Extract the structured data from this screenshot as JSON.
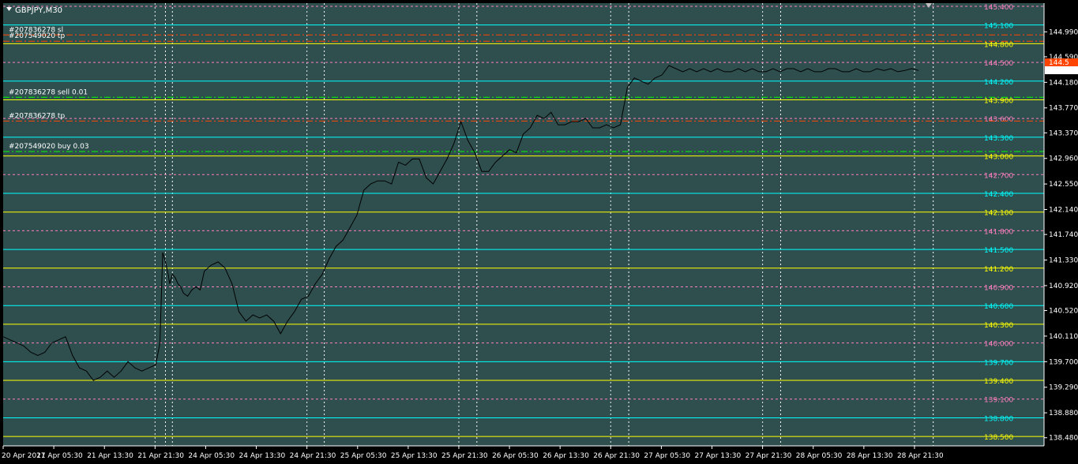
{
  "chart_data": {
    "type": "line",
    "symbol_timeframe": "GBPJPY,M30",
    "colors": {
      "plot_bg": "#2f4f4f",
      "frame_bg": "#000000",
      "price_line": "#000000",
      "grid": "#ffffff",
      "level_cyan": "#00ffff",
      "level_yellow": "#ffff00",
      "level_pink": "#ff7fbf",
      "sl_tp_red": "#ff4500",
      "entry_green": "#00ff00",
      "axis_text": "#ffffff",
      "current_price_bg": "#ffffff",
      "alert_bg": "#ff4500"
    },
    "y_axis": {
      "range": [
        138.35,
        145.45
      ],
      "ticks": [
        "144.990",
        "144.590",
        "144.180",
        "143.770",
        "143.370",
        "142.960",
        "142.550",
        "142.140",
        "141.740",
        "141.330",
        "140.920",
        "140.520",
        "140.110",
        "139.700",
        "139.290",
        "138.880",
        "138.480"
      ]
    },
    "current_price": "144.374",
    "alert_price_partial": "144.5",
    "x_axis": {
      "range": [
        0,
        1000
      ],
      "labels": [
        {
          "x": 0,
          "text": "20 Apr 2017"
        },
        {
          "x": 73,
          "text": "21 Apr 05:30"
        },
        {
          "x": 146,
          "text": "21 Apr 13:30"
        },
        {
          "x": 219,
          "text": "21 Apr 21:30"
        },
        {
          "x": 292,
          "text": "24 Apr 05:30"
        },
        {
          "x": 365,
          "text": "24 Apr 13:30"
        },
        {
          "x": 438,
          "text": "24 Apr 21:30"
        },
        {
          "x": 511,
          "text": "25 Apr 05:30"
        },
        {
          "x": 584,
          "text": "25 Apr 13:30"
        },
        {
          "x": 657,
          "text": "25 Apr 21:30"
        },
        {
          "x": 730,
          "text": "26 Apr 05:30"
        },
        {
          "x": 803,
          "text": "26 Apr 13:30"
        },
        {
          "x": 876,
          "text": "26 Apr 21:30"
        },
        {
          "x": 949,
          "text": "27 Apr 05:30"
        },
        {
          "x": 1022,
          "text": "27 Apr 13:30"
        },
        {
          "x": 1095,
          "text": "27 Apr 21:30"
        },
        {
          "x": 1168,
          "text": "28 Apr 05:30"
        },
        {
          "x": 1241,
          "text": "28 Apr 13:30"
        },
        {
          "x": 1314,
          "text": "28 Apr 21:30"
        }
      ]
    },
    "period_separators_x": [
      234,
      244,
      463,
      683,
      902,
      1121,
      1341
    ],
    "levels": [
      {
        "price": 145.4,
        "label": "145.400",
        "color": "level_pink",
        "style": "dashed"
      },
      {
        "price": 145.1,
        "label": "145.100",
        "color": "level_cyan",
        "style": "solid"
      },
      {
        "price": 144.8,
        "label": "144.800",
        "color": "level_yellow",
        "style": "solid"
      },
      {
        "price": 144.5,
        "label": "144.500",
        "color": "level_pink",
        "style": "dashed"
      },
      {
        "price": 144.2,
        "label": "144.200",
        "color": "level_cyan",
        "style": "solid"
      },
      {
        "price": 143.9,
        "label": "143.900",
        "color": "level_yellow",
        "style": "solid"
      },
      {
        "price": 143.6,
        "label": "143.600",
        "color": "level_pink",
        "style": "dashed"
      },
      {
        "price": 143.3,
        "label": "143.300",
        "color": "level_cyan",
        "style": "solid"
      },
      {
        "price": 143.0,
        "label": "143.000",
        "color": "level_yellow",
        "style": "solid"
      },
      {
        "price": 142.7,
        "label": "142.700",
        "color": "level_pink",
        "style": "dashed"
      },
      {
        "price": 142.4,
        "label": "142.400",
        "color": "level_cyan",
        "style": "solid"
      },
      {
        "price": 142.1,
        "label": "142.100",
        "color": "level_yellow",
        "style": "solid"
      },
      {
        "price": 141.8,
        "label": "141.800",
        "color": "level_pink",
        "style": "dashed"
      },
      {
        "price": 141.5,
        "label": "141.500",
        "color": "level_cyan",
        "style": "solid"
      },
      {
        "price": 141.2,
        "label": "141.200",
        "color": "level_yellow",
        "style": "solid"
      },
      {
        "price": 140.9,
        "label": "140.900",
        "color": "level_pink",
        "style": "dashed"
      },
      {
        "price": 140.6,
        "label": "140.600",
        "color": "level_cyan",
        "style": "solid"
      },
      {
        "price": 140.3,
        "label": "140.300",
        "color": "level_yellow",
        "style": "solid"
      },
      {
        "price": 140.0,
        "label": "140.000",
        "color": "level_pink",
        "style": "dashed"
      },
      {
        "price": 139.7,
        "label": "139.700",
        "color": "level_cyan",
        "style": "solid"
      },
      {
        "price": 139.4,
        "label": "139.400",
        "color": "level_yellow",
        "style": "solid"
      },
      {
        "price": 139.1,
        "label": "139.100",
        "color": "level_pink",
        "style": "dashed"
      },
      {
        "price": 138.8,
        "label": "138.800",
        "color": "level_cyan",
        "style": "solid"
      },
      {
        "price": 138.5,
        "label": "138.500",
        "color": "level_yellow",
        "style": "solid"
      }
    ],
    "trade_lines": [
      {
        "price": 144.94,
        "label": "#207836278 sl",
        "color": "sl_tp_red"
      },
      {
        "price": 144.84,
        "label": "#207549020 tp",
        "color": "sl_tp_red"
      },
      {
        "price": 143.94,
        "label": "#207836278 sell 0.01",
        "color": "entry_green"
      },
      {
        "price": 143.56,
        "label": "#207836278 tp",
        "color": "sl_tp_red"
      },
      {
        "price": 143.07,
        "label": "#207549020 buy 0.03",
        "color": "entry_green"
      }
    ],
    "series": [
      {
        "x": [
          0,
          10,
          20,
          30,
          40,
          50,
          60,
          70,
          80,
          90,
          100,
          110,
          120,
          130,
          140,
          150,
          160,
          170,
          180,
          190,
          200,
          210,
          220,
          226,
          230,
          234,
          238,
          240,
          244,
          248,
          252,
          256,
          260,
          266,
          272,
          278,
          284,
          290,
          300,
          310,
          320,
          330,
          340,
          350,
          360,
          370,
          380,
          390,
          400,
          410,
          420,
          430,
          440,
          450,
          460,
          470,
          480,
          490,
          500,
          510,
          520,
          530,
          540,
          550,
          560,
          570,
          580,
          590,
          600,
          610,
          620,
          630,
          640,
          650,
          660,
          670,
          680,
          690,
          700,
          710,
          720,
          730,
          740,
          750,
          760,
          770,
          780,
          790,
          800,
          810,
          820,
          830,
          840,
          850,
          860,
          870,
          880,
          890,
          900,
          910,
          920,
          930,
          940,
          950,
          960,
          970,
          980,
          990,
          1000,
          1010,
          1020,
          1030,
          1040,
          1050,
          1060,
          1070,
          1080,
          1090,
          1100,
          1110,
          1120,
          1130,
          1140,
          1150,
          1160,
          1170,
          1180,
          1190,
          1200,
          1210,
          1220,
          1230,
          1240,
          1250,
          1260,
          1270,
          1280,
          1290,
          1300,
          1310,
          1320
        ],
        "y": [
          140.1,
          140.05,
          140.0,
          139.95,
          139.85,
          139.8,
          139.85,
          140.0,
          140.05,
          140.1,
          139.8,
          139.6,
          139.55,
          139.4,
          139.45,
          139.55,
          139.45,
          139.55,
          139.7,
          139.6,
          139.55,
          139.6,
          139.65,
          140.0,
          141.45,
          141.3,
          141.1,
          140.95,
          141.1,
          141.05,
          140.95,
          140.9,
          140.8,
          140.75,
          140.85,
          140.9,
          140.85,
          141.15,
          141.25,
          141.3,
          141.2,
          140.95,
          140.5,
          140.35,
          140.45,
          140.4,
          140.45,
          140.35,
          140.15,
          140.35,
          140.5,
          140.7,
          140.75,
          140.95,
          141.1,
          141.35,
          141.55,
          141.65,
          141.85,
          142.05,
          142.45,
          142.55,
          142.6,
          142.6,
          142.55,
          142.9,
          142.85,
          142.95,
          142.95,
          142.65,
          142.55,
          142.75,
          142.95,
          143.2,
          143.55,
          143.25,
          143.05,
          142.75,
          142.75,
          142.9,
          143.0,
          143.1,
          143.05,
          143.35,
          143.45,
          143.65,
          143.6,
          143.7,
          143.5,
          143.5,
          143.55,
          143.55,
          143.6,
          143.45,
          143.45,
          143.5,
          143.45,
          143.5,
          144.1,
          144.25,
          144.2,
          144.15,
          144.25,
          144.3,
          144.45,
          144.4,
          144.35,
          144.4,
          144.35,
          144.4,
          144.35,
          144.4,
          144.35,
          144.35,
          144.4,
          144.35,
          144.4,
          144.35,
          144.35,
          144.4,
          144.35,
          144.4,
          144.4,
          144.35,
          144.4,
          144.35,
          144.35,
          144.4,
          144.4,
          144.35,
          144.35,
          144.4,
          144.35,
          144.35,
          144.4,
          144.37,
          144.4,
          144.35,
          144.37,
          144.4,
          144.37
        ]
      }
    ]
  }
}
